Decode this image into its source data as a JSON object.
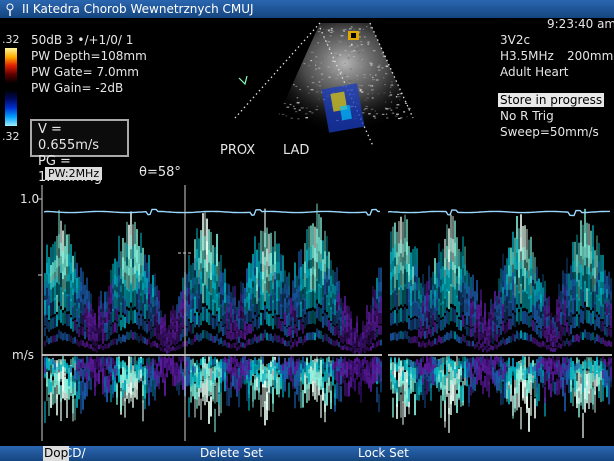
{
  "titlebar": {
    "title": "II Katedra Chorob Wewnetrznych CMUJ"
  },
  "left_panel": {
    "scale_top": ".32",
    "scale_bottom": ".32",
    "gain_line": "50dB  3 •/+1/0/ 1",
    "pw_depth": "PW Depth=108mm",
    "pw_gate": "PW Gate= 7.0mm",
    "pw_gain": "PW Gain= -2dB"
  },
  "measurements": {
    "velocity": "V = 0.655m/s",
    "gradient": "PG = 1.7mmHg"
  },
  "right_panel": {
    "time": "9:23:40 am",
    "probe": "3V2c",
    "frequency": "H3.5MHz",
    "depth": "200mm",
    "preset": "Adult Heart",
    "store_status": "Store in progress",
    "trigger": "No R Trig",
    "sweep": "Sweep=50mm/s"
  },
  "image_labels": {
    "prox": "PROX",
    "lad": "LAD"
  },
  "doppler": {
    "mode": "PW:2MHz",
    "angle": "θ=58°",
    "scale_top": "1.0",
    "unit": "m/s"
  },
  "bottom_bar": {
    "mode_prefix": "2D/CD/",
    "mode_active": "Dop",
    "delete_set": "Delete Set",
    "lock_set": "Lock Set"
  },
  "colors": {
    "titlebar": "#1f5aa0",
    "spectrum_core": "#e8fff4",
    "spectrum_mid": "#00b0c0",
    "spectrum_low": "#5a1a9a",
    "ecg": "#9ad8ff"
  }
}
